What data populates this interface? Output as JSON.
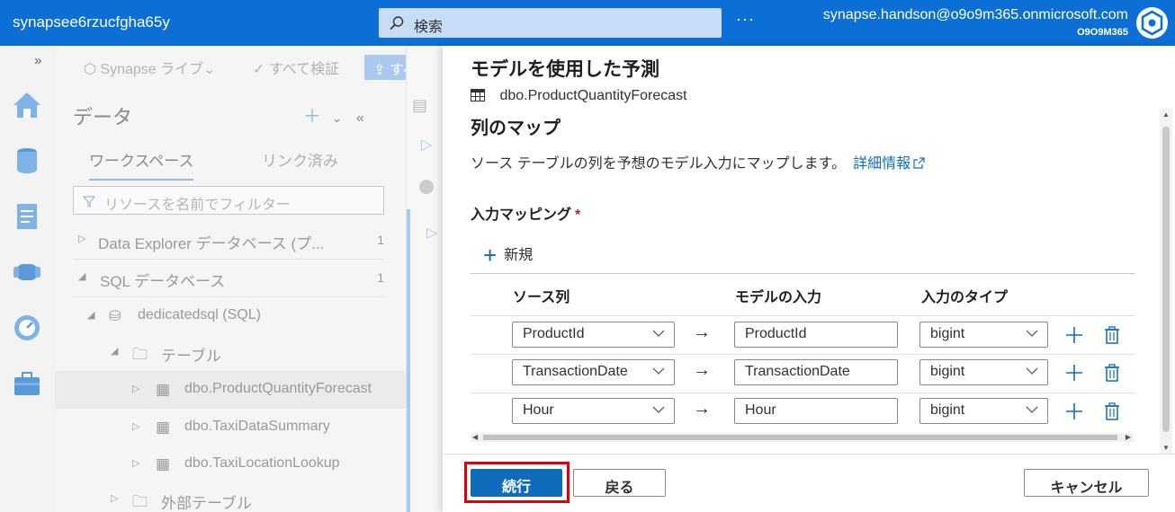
{
  "topbar": {
    "workspace": "synapsee6rzucfgha65y",
    "search_placeholder": "検索",
    "more": "···",
    "user_email": "synapse.handson@o9o9m365.onmicrosoft.com",
    "tenant": "O9O9M365"
  },
  "data_pane": {
    "toolbar": {
      "live": "Synapse ライブ",
      "validate": "すべて検証",
      "publish": "すべ"
    },
    "title": "データ",
    "tabs": {
      "workspace": "ワークスペース",
      "linked": "リンク済み"
    },
    "filter_placeholder": "リソースを名前でフィルター",
    "tree": [
      {
        "label": "Data Explorer データベース (プ...",
        "count": "1"
      },
      {
        "label": "SQL データベース",
        "count": "1"
      },
      {
        "label": "dedicatedsql (SQL)",
        "count": ""
      },
      {
        "label": "テーブル",
        "count": ""
      },
      {
        "label": "dbo.ProductQuantityForecast",
        "count": ""
      },
      {
        "label": "dbo.TaxiDataSummary",
        "count": ""
      },
      {
        "label": "dbo.TaxiLocationLookup",
        "count": ""
      },
      {
        "label": "外部テーブル",
        "count": ""
      }
    ]
  },
  "panel": {
    "title": "モデルを使用した予測",
    "model": "dbo.ProductQuantityForecast",
    "section": "列のマップ",
    "description": "ソース テーブルの列を予想のモデル入力にマップします。",
    "learn_more": "詳細情報",
    "input_mapping": "入力マッピング",
    "required": "*",
    "new": "新規",
    "columns": {
      "source": "ソース列",
      "model_input": "モデルの入力",
      "input_type": "入力のタイプ"
    },
    "rows": [
      {
        "source": "ProductId",
        "arrow": "→",
        "model_input": "ProductId",
        "type": "bigint"
      },
      {
        "source": "TransactionDate",
        "arrow": "→",
        "model_input": "TransactionDate",
        "type": "bigint"
      },
      {
        "source": "Hour",
        "arrow": "→",
        "model_input": "Hour",
        "type": "bigint"
      }
    ],
    "buttons": {
      "continue": "続行",
      "back": "戻る",
      "cancel": "キャンセル"
    }
  },
  "colors": {
    "topbar": "#0b6fd6",
    "accent": "#0f6cbd",
    "highlight": "#e0000b"
  }
}
